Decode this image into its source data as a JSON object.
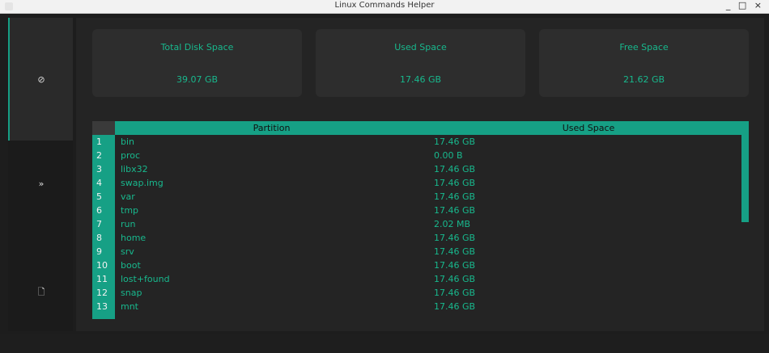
{
  "window": {
    "title": "Linux Commands Helper",
    "controls": "_ □ ×"
  },
  "sidebar": {
    "items": [
      {
        "icon": "disk-icon",
        "glyph": "⊘"
      },
      {
        "icon": "chevrons-right-icon",
        "glyph": "»"
      },
      {
        "icon": "file-icon",
        "glyph": "🗋"
      }
    ],
    "active_color": "#16a085"
  },
  "cards": [
    {
      "label": "Total Disk Space",
      "value": "39.07 GB"
    },
    {
      "label": "Used Space",
      "value": "17.46 GB"
    },
    {
      "label": "Free Space",
      "value": "21.62 GB"
    }
  ],
  "table": {
    "columns": [
      "Partition",
      "Used Space"
    ],
    "rows": [
      {
        "num": "1",
        "partition": "bin",
        "used": "17.46 GB"
      },
      {
        "num": "2",
        "partition": "proc",
        "used": "0.00 B"
      },
      {
        "num": "3",
        "partition": "libx32",
        "used": "17.46 GB"
      },
      {
        "num": "4",
        "partition": "swap.img",
        "used": "17.46 GB"
      },
      {
        "num": "5",
        "partition": "var",
        "used": "17.46 GB"
      },
      {
        "num": "6",
        "partition": "tmp",
        "used": "17.46 GB"
      },
      {
        "num": "7",
        "partition": "run",
        "used": "2.02 MB"
      },
      {
        "num": "8",
        "partition": "home",
        "used": "17.46 GB"
      },
      {
        "num": "9",
        "partition": "srv",
        "used": "17.46 GB"
      },
      {
        "num": "10",
        "partition": "boot",
        "used": "17.46 GB"
      },
      {
        "num": "11",
        "partition": "lost+found",
        "used": "17.46 GB"
      },
      {
        "num": "12",
        "partition": "snap",
        "used": "17.46 GB"
      },
      {
        "num": "13",
        "partition": "mnt",
        "used": "17.46 GB"
      }
    ]
  },
  "colors": {
    "accent": "#16a085",
    "text_accent": "#18b88d",
    "bg": "#242424",
    "card": "#2d2d2d"
  }
}
